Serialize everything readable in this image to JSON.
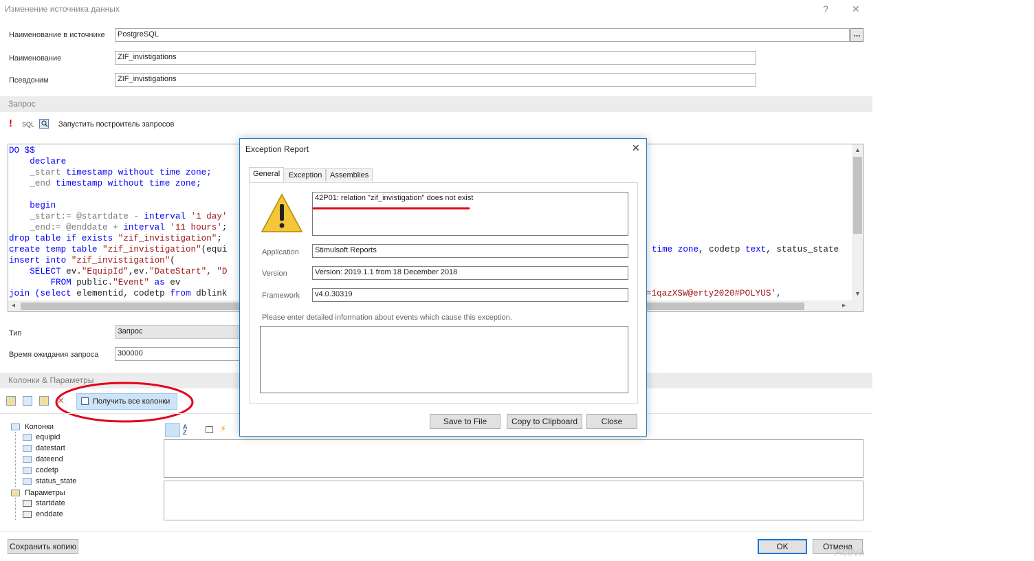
{
  "window": {
    "title": "Изменение источника данных",
    "help": "?",
    "close": "✕"
  },
  "fields": {
    "source_name_label": "Наименование в источнике",
    "source_name_value": "PostgreSQL",
    "ellipsis": "...",
    "name_label": "Наименование",
    "name_value": "ZIF_invistigations",
    "alias_label": "Псевдоним",
    "alias_value": "ZIF_invistigations"
  },
  "query": {
    "section_title": "Запрос",
    "warn_glyph": "!",
    "sql_label": "SQL",
    "builder_label": "Запустить построитель запросов"
  },
  "code_lines": [
    [
      {
        "t": "DO $$",
        "c": "kw"
      }
    ],
    [
      {
        "t": "    declare",
        "c": "kw"
      }
    ],
    [
      {
        "t": "    _start ",
        "c": "par"
      },
      {
        "t": "timestamp without time zone;",
        "c": "kw"
      }
    ],
    [
      {
        "t": "    _end ",
        "c": "par"
      },
      {
        "t": "timestamp without time zone;",
        "c": "kw"
      }
    ],
    [
      {
        "t": "",
        "c": "std"
      }
    ],
    [
      {
        "t": "    begin",
        "c": "kw"
      }
    ],
    [
      {
        "t": "    _start",
        "c": "par"
      },
      {
        "t": ":= @startdate - ",
        "c": "par"
      },
      {
        "t": "interval ",
        "c": "kw"
      },
      {
        "t": "'1 day'",
        "c": "str"
      }
    ],
    [
      {
        "t": "    _end",
        "c": "par"
      },
      {
        "t": ":= @enddate + ",
        "c": "par"
      },
      {
        "t": "interval ",
        "c": "kw"
      },
      {
        "t": "'11 hours'",
        "c": "str"
      },
      {
        "t": ";",
        "c": "std"
      }
    ],
    [
      {
        "t": "drop table if exists ",
        "c": "kw"
      },
      {
        "t": "\"zif_invistigation\"",
        "c": "str"
      },
      {
        "t": ";",
        "c": "std"
      }
    ],
    [
      {
        "t": "create temp table ",
        "c": "kw"
      },
      {
        "t": "\"zif_invistigation\"",
        "c": "str"
      },
      {
        "t": "(equi",
        "c": "std"
      }
    ],
    [
      {
        "t": "insert into ",
        "c": "kw"
      },
      {
        "t": "\"zif_invistigation\"",
        "c": "str"
      },
      {
        "t": "(",
        "c": "std"
      }
    ],
    [
      {
        "t": "    SELECT ",
        "c": "kw"
      },
      {
        "t": "ev.",
        "c": "std"
      },
      {
        "t": "\"EquipId\"",
        "c": "str"
      },
      {
        "t": ",ev.",
        "c": "std"
      },
      {
        "t": "\"DateStart\"",
        "c": "str"
      },
      {
        "t": ", ",
        "c": "std"
      },
      {
        "t": "\"D",
        "c": "str"
      }
    ],
    [
      {
        "t": "        FROM ",
        "c": "kw"
      },
      {
        "t": "public.",
        "c": "std"
      },
      {
        "t": "\"Event\"",
        "c": "str"
      },
      {
        "t": " as ",
        "c": "kw"
      },
      {
        "t": "ev",
        "c": "std"
      }
    ],
    [
      {
        "t": "join ",
        "c": "kw"
      },
      {
        "t": "(select ",
        "c": "kw"
      },
      {
        "t": "elementid, codetp ",
        "c": "std"
      },
      {
        "t": "from ",
        "c": "kw"
      },
      {
        "t": "dblink",
        "c": "std"
      }
    ]
  ],
  "code_right": [
    [
      {
        "t": "time zone",
        "c": "kw"
      },
      {
        "t": ", codetp ",
        "c": "std"
      },
      {
        "t": "text",
        "c": "kw"
      },
      {
        "t": ", status_state",
        "c": "std"
      }
    ],
    [
      {
        "t": "=1qazXSW@erty2020#POLYUS'",
        "c": "str"
      },
      {
        "t": ",",
        "c": "std"
      }
    ]
  ],
  "type": {
    "label": "Тип",
    "value": "Запрос",
    "timeout_label": "Время ожидания запроса",
    "timeout_value": "300000"
  },
  "columns_section": {
    "title": "Колонки & Параметры",
    "get_all_button": "Получить все колонки"
  },
  "tree": {
    "columns_label": "Колонки",
    "columns": [
      "equipid",
      "datestart",
      "dateend",
      "codetp",
      "status_state"
    ],
    "params_label": "Параметры",
    "params": [
      "startdate",
      "enddate"
    ]
  },
  "footer": {
    "save_copy": "Сохранить копию",
    "ok": "OK",
    "cancel": "Отмена",
    "watermark": "Activa"
  },
  "dialog": {
    "title": "Exception Report",
    "close": "✕",
    "tabs": [
      "General",
      "Exception",
      "Assemblies"
    ],
    "message": "42P01: relation \"zif_invistigation\" does not exist",
    "application_label": "Application",
    "application_value": "Stimulsoft Reports",
    "version_label": "Version",
    "version_value": "Version: 2019.1.1 from 18 December 2018",
    "framework_label": "Framework",
    "framework_value": "v4.0.30319",
    "details_prompt": "Please enter detailed information about events which cause this exception.",
    "buttons": {
      "save": "Save to File",
      "copy": "Copy to Clipboard",
      "close": "Close"
    }
  },
  "colors": {
    "keyword": "#0000ff",
    "string": "#a31515",
    "accent": "#1d7ec6",
    "annotation": "#e3001b"
  }
}
